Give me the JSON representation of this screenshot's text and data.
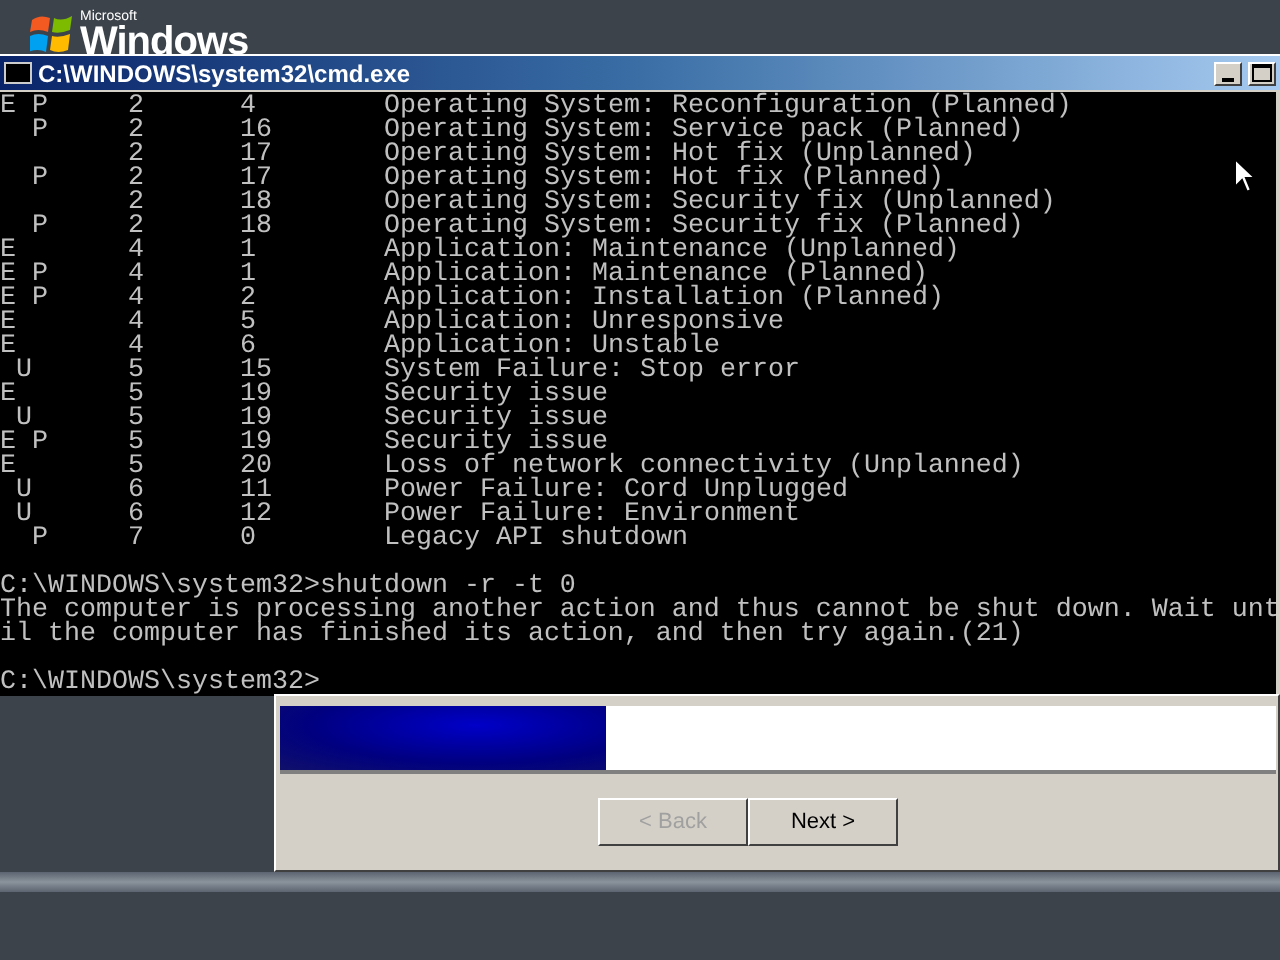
{
  "desktop": {
    "logo": {
      "brand": "Microsoft",
      "name": "Windows"
    }
  },
  "console": {
    "title": "C:\\WINDOWS\\system32\\cmd.exe",
    "rows": [
      {
        "flags": "E P",
        "major": "2",
        "minor": "4",
        "reason": "Operating System: Reconfiguration (Planned)"
      },
      {
        "flags": "  P",
        "major": "2",
        "minor": "16",
        "reason": "Operating System: Service pack (Planned)"
      },
      {
        "flags": "",
        "major": "2",
        "minor": "17",
        "reason": "Operating System: Hot fix (Unplanned)"
      },
      {
        "flags": "  P",
        "major": "2",
        "minor": "17",
        "reason": "Operating System: Hot fix (Planned)"
      },
      {
        "flags": "",
        "major": "2",
        "minor": "18",
        "reason": "Operating System: Security fix (Unplanned)"
      },
      {
        "flags": "  P",
        "major": "2",
        "minor": "18",
        "reason": "Operating System: Security fix (Planned)"
      },
      {
        "flags": "E",
        "major": "4",
        "minor": "1",
        "reason": "Application: Maintenance (Unplanned)"
      },
      {
        "flags": "E P",
        "major": "4",
        "minor": "1",
        "reason": "Application: Maintenance (Planned)"
      },
      {
        "flags": "E P",
        "major": "4",
        "minor": "2",
        "reason": "Application: Installation (Planned)"
      },
      {
        "flags": "E",
        "major": "4",
        "minor": "5",
        "reason": "Application: Unresponsive"
      },
      {
        "flags": "E",
        "major": "4",
        "minor": "6",
        "reason": "Application: Unstable"
      },
      {
        "flags": " U",
        "major": "5",
        "minor": "15",
        "reason": "System Failure: Stop error"
      },
      {
        "flags": "E",
        "major": "5",
        "minor": "19",
        "reason": "Security issue"
      },
      {
        "flags": " U",
        "major": "5",
        "minor": "19",
        "reason": "Security issue"
      },
      {
        "flags": "E P",
        "major": "5",
        "minor": "19",
        "reason": "Security issue"
      },
      {
        "flags": "E",
        "major": "5",
        "minor": "20",
        "reason": "Loss of network connectivity (Unplanned)"
      },
      {
        "flags": " U",
        "major": "6",
        "minor": "11",
        "reason": "Power Failure: Cord Unplugged"
      },
      {
        "flags": " U",
        "major": "6",
        "minor": "12",
        "reason": "Power Failure: Environment"
      },
      {
        "flags": "  P",
        "major": "7",
        "minor": "0",
        "reason": "Legacy API shutdown"
      }
    ],
    "lines": [
      {
        "text": "C:\\WINDOWS\\system32>shutdown -r -t 0",
        "gap_before": true
      },
      {
        "text": "The computer is processing another action and thus cannot be shut down. Wait unt",
        "gap_before": false
      },
      {
        "text": "il the computer has finished its action, and then try again.(21)",
        "gap_before": false
      },
      {
        "text": "C:\\WINDOWS\\system32>",
        "gap_before": true
      }
    ]
  },
  "wizard": {
    "buttons": [
      {
        "label": "< Back",
        "disabled": true
      },
      {
        "label": "Next >",
        "disabled": false
      }
    ]
  }
}
